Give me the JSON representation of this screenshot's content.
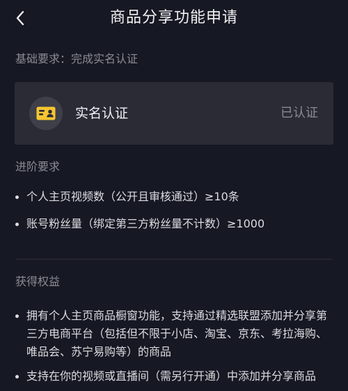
{
  "header": {
    "title": "商品分享功能申请"
  },
  "basic": {
    "label": "基础要求：完成实名认证",
    "card": {
      "title": "实名认证",
      "status": "已认证",
      "icon": "id-card-icon",
      "icon_color": "#f7c531"
    }
  },
  "advanced": {
    "label": "进阶要求",
    "items": [
      "个人主页视频数（公开且审核通过）≥10条",
      "账号粉丝量（绑定第三方粉丝量不计数）≥1000"
    ]
  },
  "benefits": {
    "label": "获得权益",
    "items": [
      "拥有个人主页商品橱窗功能，支持通过精选联盟添加并分享第三方电商平台（包括但不限于小店、淘宝、京东、考拉海购、唯品会、苏宁易购等）的商品",
      "支持在你的视频或直播间（需另行开通）中添加并分享商品"
    ]
  }
}
